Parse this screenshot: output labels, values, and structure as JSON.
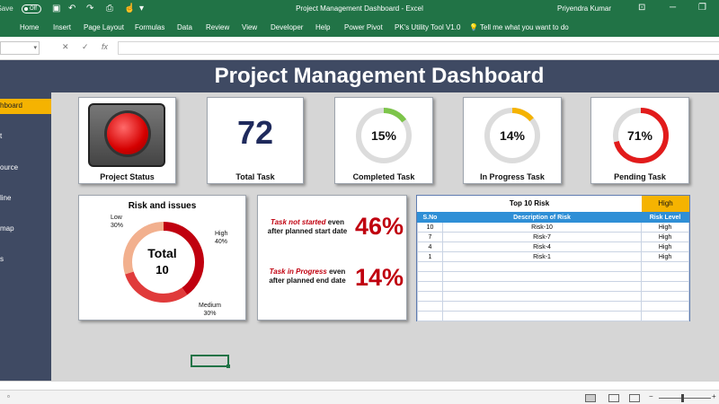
{
  "titlebar": {
    "autosave": "AutoSave",
    "toggle": "Off",
    "title": "Project Management Dashboard  -  Excel",
    "user": "Priyendra Kumar",
    "icons": [
      "save-icon",
      "undo-icon",
      "redo-icon",
      "camera-icon",
      "touch-icon",
      "more-icon"
    ]
  },
  "menu": [
    "Home",
    "Insert",
    "Page Layout",
    "Formulas",
    "Data",
    "Review",
    "View",
    "Developer",
    "Help",
    "Power Pivot",
    "PK's Utility Tool V1.0",
    "Tell me what you want to do"
  ],
  "formula": {
    "name_box": "",
    "cancel": "✕",
    "enter": "✓",
    "fx": "fx",
    "value": ""
  },
  "dashboard": {
    "title": "Project Management Dashboard",
    "sidebar": [
      "hboard",
      "t",
      "ource",
      "line",
      "map",
      "s"
    ],
    "cards": {
      "status_label": "Project Status",
      "total_value": "72",
      "total_label": "Total Task",
      "completed_value": "15%",
      "completed_label": "Completed Task",
      "completed_pct": 15,
      "progress_value": "14%",
      "progress_label": "In Progress Task",
      "progress_pct": 14,
      "pending_value": "71%",
      "pending_label": "Pending Task",
      "pending_pct": 71
    },
    "risk_chart": {
      "title": "Risk and issues",
      "total_label": "Total",
      "total_value": "10",
      "low_label": "Low",
      "low_pct": "30%",
      "high_label": "High",
      "high_pct": "40%",
      "medium_label": "Medium",
      "medium_pct": "30%",
      "values": {
        "low": 30,
        "high": 40,
        "medium": 30
      }
    },
    "kpis": {
      "not_started_red": "Task not started",
      "not_started_rest": " even after planned start date",
      "not_started_value": "46%",
      "in_progress_red": "Task in Progress",
      "in_progress_rest": " even after planned end date",
      "in_progress_value": "14%"
    },
    "risk_table": {
      "title": "Top 10 Risk",
      "filter": "High",
      "headers": [
        "S.No",
        "Description of Risk",
        "Risk Level"
      ],
      "rows": [
        [
          "10",
          "Risk-10",
          "High"
        ],
        [
          "7",
          "Risk-7",
          "High"
        ],
        [
          "4",
          "Risk-4",
          "High"
        ],
        [
          "1",
          "Risk-1",
          "High"
        ]
      ],
      "empty_rows": 6
    }
  },
  "colors": {
    "excel_green": "#217346",
    "header_navy": "#3f4a63",
    "accent_yellow": "#f5b301",
    "green_ring": "#7dc54a",
    "red": "#c0000f",
    "table_blue": "#2f8fd6",
    "low_peach": "#f2b08e",
    "medium_red": "#e03b3b",
    "high_darkred": "#c0000f"
  }
}
